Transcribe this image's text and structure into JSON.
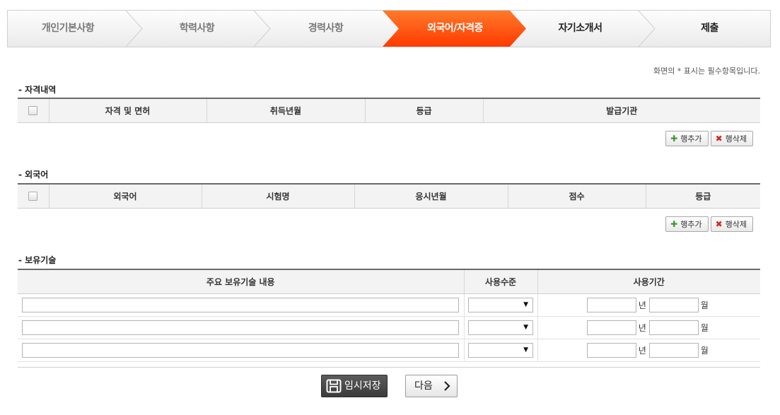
{
  "steps": [
    {
      "label": "개인기본사항",
      "state": "done"
    },
    {
      "label": "학력사항",
      "state": "done"
    },
    {
      "label": "경력사항",
      "state": "done"
    },
    {
      "label": "외국어/자격증",
      "state": "active"
    },
    {
      "label": "자기소개서",
      "state": "todo"
    },
    {
      "label": "제출",
      "state": "todo"
    }
  ],
  "notice": "화면의 * 표시는 필수항목입니다.",
  "certificates": {
    "title": "- 자격내역",
    "columns": [
      "자격 및 면허",
      "취득년월",
      "등급",
      "발급기관"
    ]
  },
  "languages": {
    "title": "- 외국어",
    "columns": [
      "외국어",
      "시험명",
      "응시년월",
      "점수",
      "등급"
    ]
  },
  "skills": {
    "title": "- 보유기술",
    "columns": [
      "주요 보유기술 내용",
      "사용수준",
      "사용기간"
    ],
    "year_unit": "년",
    "month_unit": "월",
    "select_arrow": "▼",
    "rows": [
      {
        "content": "",
        "level": "",
        "years": "",
        "months": ""
      },
      {
        "content": "",
        "level": "",
        "years": "",
        "months": ""
      },
      {
        "content": "",
        "level": "",
        "years": "",
        "months": ""
      }
    ]
  },
  "row_buttons": {
    "add": "행추가",
    "delete": "행삭제"
  },
  "actions": {
    "save": "임시저장",
    "next": "다음"
  },
  "colors": {
    "accent": "#ff5a12",
    "accent_dark": "#ff3f00",
    "header_rule": "#6a6a6a"
  }
}
